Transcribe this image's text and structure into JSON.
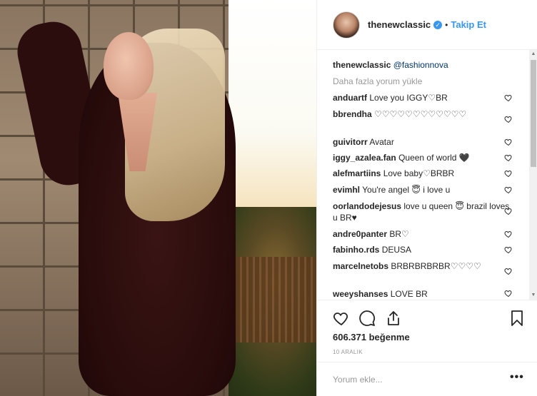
{
  "post": {
    "username": "thenewclassic",
    "verified_icon": "verified-badge-icon",
    "dot": "•",
    "follow_label": "Takip Et"
  },
  "caption": {
    "username": "thenewclassic",
    "mention": "@fashionnova"
  },
  "load_more": "Daha fazla yorum yükle",
  "comments": [
    {
      "user": "anduartf",
      "text": "Love you IGGY♡BR"
    },
    {
      "user": "bbrendha",
      "text": "♡♡♡♡♡♡♡♡♡♡♡♡"
    },
    {
      "user": "guivitorr",
      "text": "Avatar"
    },
    {
      "user": "iggy_azalea.fan",
      "text": "Queen of world 🖤"
    },
    {
      "user": "alefmartiins",
      "text": "Love baby♡BRBR"
    },
    {
      "user": "evimhl",
      "text": "You're angel 😇 i love u"
    },
    {
      "user": "oorlandodejesus",
      "text": "love u queen 😇 brazil loves u BR♥"
    },
    {
      "user": "andre0panter",
      "text": "BR♡"
    },
    {
      "user": "fabinho.rds",
      "text": "DEUSA"
    },
    {
      "user": "marcelnetobs",
      "text": "BRBRBRBRBR♡♡♡♡"
    },
    {
      "user": "weeyshanses",
      "text": "LOVE BR"
    }
  ],
  "likes": "606.371 beğenme",
  "date": "10 ARALIK",
  "comment_input": {
    "placeholder": "Yorum ekle..."
  },
  "more_label": "•••",
  "colors": {
    "link": "#3897f0",
    "text": "#262626",
    "muted": "#999999"
  }
}
